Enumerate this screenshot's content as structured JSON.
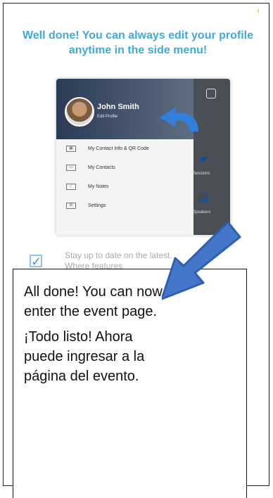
{
  "instruction": {
    "headline": "Well done! You can always edit your profile anytime in the side menu!"
  },
  "mockup": {
    "user_name": "John Smith",
    "edit_profile": "Edit Profile",
    "menu_items": [
      {
        "icon": "qr-code-icon",
        "label": "My Contact Info & QR Code"
      },
      {
        "icon": "contacts-icon",
        "label": "My Contacts"
      },
      {
        "icon": "notes-icon",
        "label": "My Notes"
      },
      {
        "icon": "settings-icon",
        "label": "Settings"
      }
    ],
    "tile_labels": [
      "Sessions",
      "Speakers"
    ]
  },
  "preference": {
    "text": "Stay up to date on the latest. Where features"
  },
  "callout": {
    "english_line_1": "All done!  You can now",
    "english_line_2": "enter the event page.",
    "spanish_line_1": "¡Todo listo!  Ahora",
    "spanish_line_2": "puede ingresar a la",
    "spanish_line_3": "página del evento."
  },
  "colors": {
    "headline_blue": "#3fa9df",
    "arrow_blue": "#4477c9",
    "checkbox_blue": "#3b9fe2"
  }
}
